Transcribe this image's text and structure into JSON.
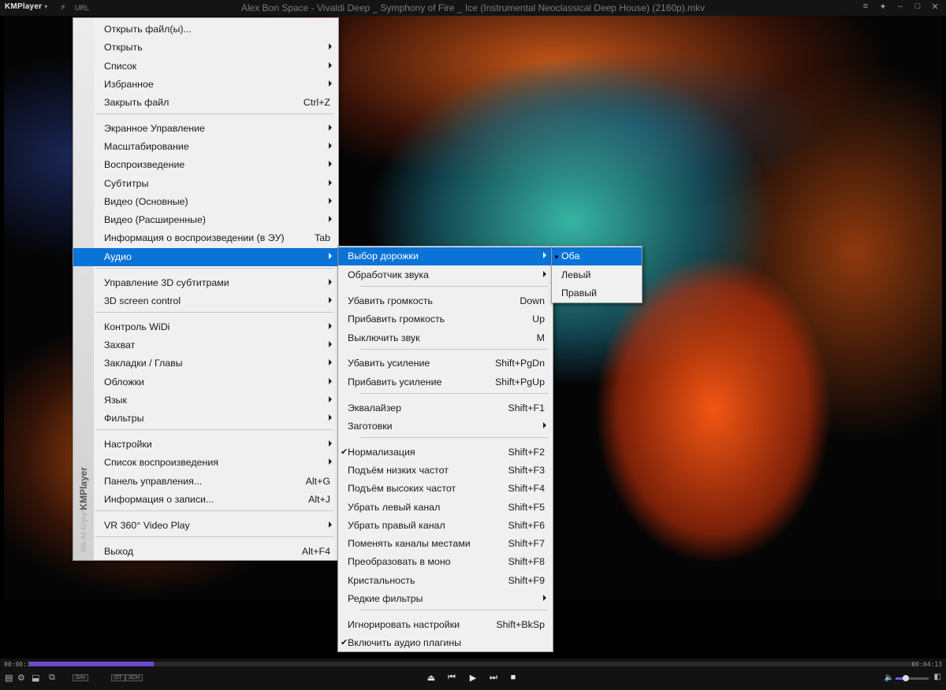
{
  "window": {
    "app_logo": "KMPlayer",
    "url_label": "URL",
    "title": "Alex Bon Space - Vivaldi Deep _ Symphony of Fire _ Ice (Instrumental Neoclassical Deep House) (2160p).mkv"
  },
  "player": {
    "time_current": "00:00:35",
    "time_total": "00:04:13",
    "progress_fraction": 0.14,
    "volume_fraction": 0.3,
    "badge_1": "S/H",
    "badge_2": "OT",
    "badge_3": "3CH"
  },
  "main_menu": {
    "side_brand": "KMPlayer",
    "side_slogan": "We All Enjoy!",
    "items": [
      {
        "label": "Открыть файл(ы)...",
        "shortcut": ""
      },
      {
        "label": "Открыть",
        "shortcut": "",
        "submenu": true
      },
      {
        "label": "Список",
        "shortcut": "",
        "submenu": true
      },
      {
        "label": "Избранное",
        "shortcut": "",
        "submenu": true
      },
      {
        "label": "Закрыть файл",
        "shortcut": "Ctrl+Z"
      },
      {
        "label": "Экранное Управление",
        "shortcut": "",
        "submenu": true
      },
      {
        "label": "Масштабирование",
        "shortcut": "",
        "submenu": true
      },
      {
        "label": "Воспроизведение",
        "shortcut": "",
        "submenu": true
      },
      {
        "label": "Субтитры",
        "shortcut": "",
        "submenu": true
      },
      {
        "label": "Видео (Основные)",
        "shortcut": "",
        "submenu": true
      },
      {
        "label": "Видео (Расширенные)",
        "shortcut": "",
        "submenu": true
      },
      {
        "label": "Информация о воспроизведении (в ЭУ)",
        "shortcut": "Tab"
      },
      {
        "label": "Аудио",
        "shortcut": "",
        "submenu": true,
        "highlighted": true
      },
      {
        "label": "Управление 3D субтитрами",
        "shortcut": "",
        "submenu": true
      },
      {
        "label": "3D screen control",
        "shortcut": "",
        "submenu": true
      },
      {
        "label": "Контроль WiDi",
        "shortcut": "",
        "submenu": true
      },
      {
        "label": "Захват",
        "shortcut": "",
        "submenu": true
      },
      {
        "label": "Закладки / Главы",
        "shortcut": "",
        "submenu": true
      },
      {
        "label": "Обложки",
        "shortcut": "",
        "submenu": true
      },
      {
        "label": "Язык",
        "shortcut": "",
        "submenu": true
      },
      {
        "label": "Фильтры",
        "shortcut": "",
        "submenu": true
      },
      {
        "label": "Настройки",
        "shortcut": "",
        "submenu": true
      },
      {
        "label": "Список воспроизведения",
        "shortcut": "",
        "submenu": true
      },
      {
        "label": "Панель управления...",
        "shortcut": "Alt+G"
      },
      {
        "label": "Информация о записи...",
        "shortcut": "Alt+J"
      },
      {
        "label": "VR 360° Video Play",
        "shortcut": "",
        "submenu": true
      },
      {
        "label": "Выход",
        "shortcut": "Alt+F4"
      }
    ]
  },
  "audio_menu": {
    "items": [
      {
        "label": "Выбор дорожки",
        "shortcut": "",
        "submenu": true,
        "highlighted": true
      },
      {
        "label": "Обработчик звука",
        "shortcut": "",
        "submenu": true
      },
      {
        "label": "Убавить громкость",
        "shortcut": "Down"
      },
      {
        "label": "Прибавить громкость",
        "shortcut": "Up"
      },
      {
        "label": "Выключить звук",
        "shortcut": "M"
      },
      {
        "label": "Убавить усиление",
        "shortcut": "Shift+PgDn"
      },
      {
        "label": "Прибавить усиление",
        "shortcut": "Shift+PgUp"
      },
      {
        "label": "Эквалайзер",
        "shortcut": "Shift+F1"
      },
      {
        "label": "Заготовки",
        "shortcut": "",
        "submenu": true
      },
      {
        "label": "Нормализация",
        "shortcut": "Shift+F2",
        "checked": true
      },
      {
        "label": "Подъём низких частот",
        "shortcut": "Shift+F3"
      },
      {
        "label": "Подъём высоких частот",
        "shortcut": "Shift+F4"
      },
      {
        "label": "Убрать левый канал",
        "shortcut": "Shift+F5"
      },
      {
        "label": "Убрать правый канал",
        "shortcut": "Shift+F6"
      },
      {
        "label": "Поменять каналы местами",
        "shortcut": "Shift+F7"
      },
      {
        "label": "Преобразовать в моно",
        "shortcut": "Shift+F8"
      },
      {
        "label": "Кристальность",
        "shortcut": "Shift+F9"
      },
      {
        "label": "Редкие фильтры",
        "shortcut": "",
        "submenu": true
      },
      {
        "label": "Игнорировать настройки",
        "shortcut": "Shift+BkSp"
      },
      {
        "label": "Включить аудио плагины",
        "shortcut": "",
        "checked": true
      }
    ]
  },
  "track_menu": {
    "items": [
      {
        "label": "Оба",
        "selected": true,
        "highlighted": true
      },
      {
        "label": "Левый"
      },
      {
        "label": "Правый"
      }
    ]
  },
  "icons": {
    "logo_icon": "km-logo-icon",
    "eject": "⏏",
    "prev": "⏮",
    "play": "▶",
    "next": "⏭",
    "stop": "■"
  }
}
